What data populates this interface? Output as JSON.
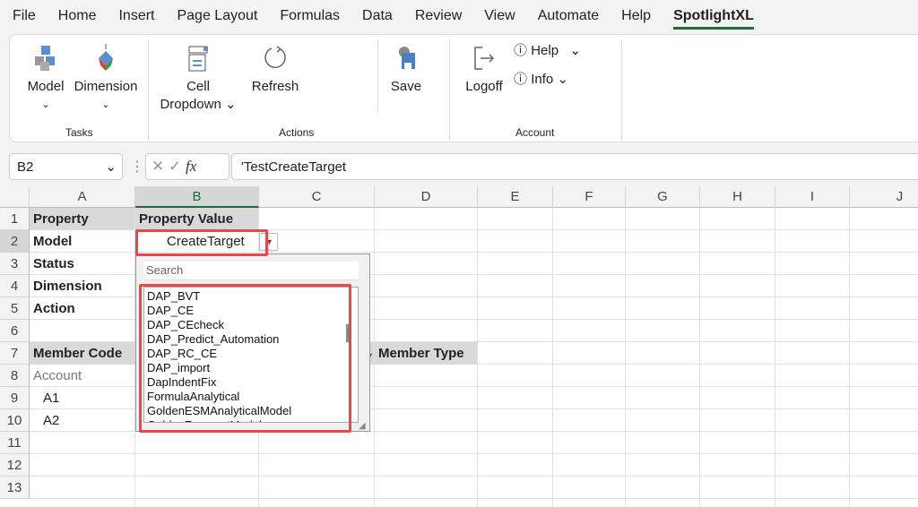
{
  "menu": {
    "tabs": [
      "File",
      "Home",
      "Insert",
      "Page Layout",
      "Formulas",
      "Data",
      "Review",
      "View",
      "Automate",
      "Help",
      "SpotlightXL"
    ],
    "active": "SpotlightXL"
  },
  "ribbon": {
    "model": "Model",
    "dimension": "Dimension",
    "tasks": "Tasks",
    "cell": "Cell",
    "dropdown": "Dropdown",
    "refresh": "Refresh",
    "actions": "Actions",
    "save": "Save",
    "logoff": "Logoff",
    "help": "Help",
    "info": "Info",
    "account": "Account"
  },
  "formula_bar": {
    "name_box": "B2",
    "formula": "'TestCreateTarget",
    "fx": "fx"
  },
  "columns": [
    "A",
    "B",
    "C",
    "D",
    "E",
    "F",
    "G",
    "H",
    "I",
    "J"
  ],
  "rows": [
    "1",
    "2",
    "3",
    "4",
    "5",
    "6",
    "7",
    "8",
    "9",
    "10",
    "11",
    "12",
    "13"
  ],
  "cells": {
    "A1": "Property",
    "B1": "Property Value",
    "A2": "Model",
    "B2": "CreateTarget",
    "A3": "Status",
    "A4": "Dimension",
    "A5": "Action",
    "A7": "Member Code",
    "D7": "Member Type",
    "A8": "Account",
    "A9": "A1",
    "A10": "A2"
  },
  "dropdown": {
    "search_placeholder": "Search",
    "items": [
      "DAP_BVT",
      "DAP_CE",
      "DAP_CEcheck",
      "DAP_Predict_Automation",
      "DAP_RC_CE",
      "DAP_import",
      "DapIndentFix",
      "FormulaAnalytical",
      "GoldenESMAnalyticalModel",
      "GoldenForecastModel"
    ]
  },
  "colors": {
    "accent": "#1e6b3c",
    "highlight": "#e8474b"
  }
}
